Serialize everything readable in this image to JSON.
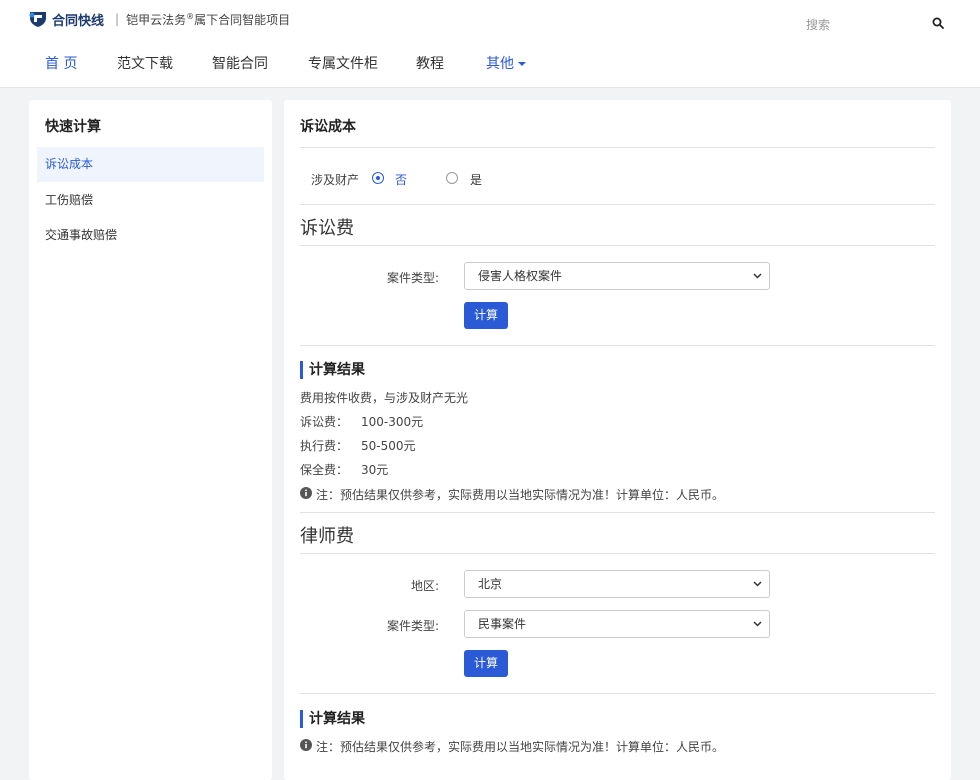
{
  "header": {
    "logo_text": "合同快线",
    "logo_sep": "|",
    "tagline_main": "铠甲云法务",
    "tagline_sup": "®",
    "tagline_rest": "属下合同智能项目",
    "search_placeholder": "搜索"
  },
  "nav": {
    "items": [
      {
        "label": "首 页"
      },
      {
        "label": "范文下载"
      },
      {
        "label": "智能合同"
      },
      {
        "label": "专属文件柜"
      },
      {
        "label": "教程"
      },
      {
        "label": "其他"
      }
    ]
  },
  "sidebar": {
    "title": "快速计算",
    "items": [
      {
        "label": "诉讼成本"
      },
      {
        "label": "工伤赔偿"
      },
      {
        "label": "交通事故赔偿"
      }
    ]
  },
  "main": {
    "title": "诉讼成本",
    "property": {
      "label": "涉及财产",
      "option_no": "否",
      "option_yes": "是",
      "selected": "否"
    },
    "litigation": {
      "title": "诉讼费",
      "case_type_label": "案件类型:",
      "case_type_value": "侵害人格权案件",
      "button": "计算",
      "result_title": "计算结果",
      "result_desc": "费用按件收费，与涉及财产无光",
      "rows": [
        {
          "label": "诉讼费：",
          "value": "100-300元"
        },
        {
          "label": "执行费：",
          "value": "50-500元"
        },
        {
          "label": "保全费：",
          "value": "30元"
        }
      ],
      "note": "注：预估结果仅供参考，实际费用以当地实际情况为准！计算单位：人民币。"
    },
    "lawyer": {
      "title": "律师费",
      "region_label": "地区:",
      "region_value": "北京",
      "case_type_label": "案件类型:",
      "case_type_value": "民事案件",
      "button": "计算",
      "result_title": "计算结果",
      "note": "注：预估结果仅供参考，实际费用以当地实际情况为准！计算单位：人民币。"
    }
  },
  "colors": {
    "accent": "#2a5ad6",
    "logo": "#1d3a6e",
    "background": "#f2f3f5"
  }
}
